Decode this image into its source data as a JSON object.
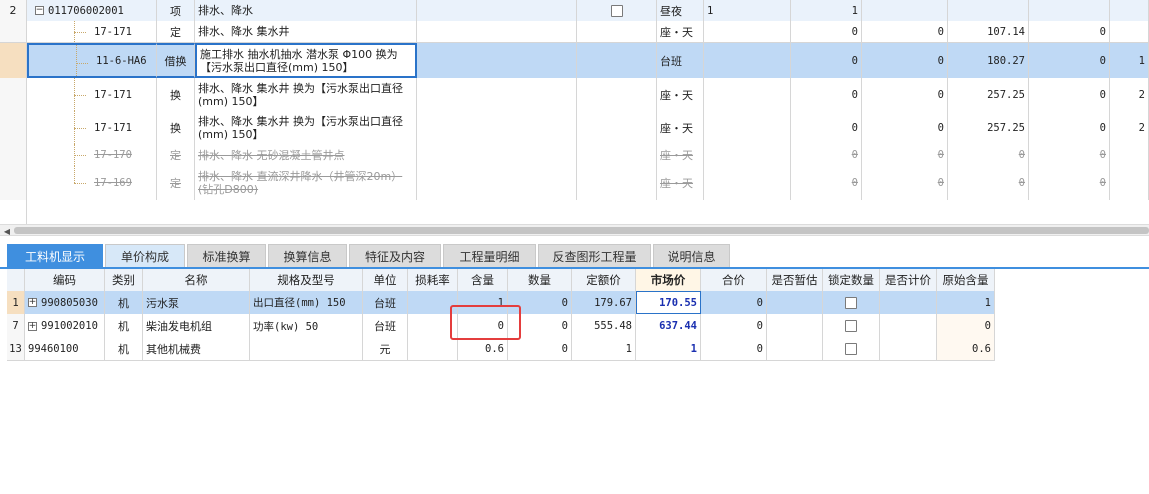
{
  "top_grid": {
    "rows": [
      {
        "num": "2",
        "code": "011706002001",
        "type": "项",
        "name": "排水、降水",
        "unit": "昼夜",
        "qty_expr": "1",
        "qty": "1",
        "amount": "",
        "unit_price": "",
        "total": "",
        "c13": "",
        "style": "header",
        "has_checkbox": true,
        "expander": "−"
      },
      {
        "num": "",
        "code": "17-171",
        "type": "定",
        "name": "排水、降水 集水井",
        "unit": "座・天",
        "qty_expr": "",
        "qty": "0",
        "amount": "0",
        "unit_price": "107.14",
        "total": "0",
        "c13": "",
        "style": "normal"
      },
      {
        "num": "",
        "code": "11-6-HA6",
        "type": "借换",
        "name": "施工排水 抽水机抽水 潜水泵 Φ100  换为【污水泵出口直径(mm) 150】",
        "unit": "台班",
        "qty_expr": "",
        "qty": "0",
        "amount": "0",
        "unit_price": "180.27",
        "total": "0",
        "c13": "1",
        "style": "selected"
      },
      {
        "num": "",
        "code": "17-171",
        "type": "换",
        "name": "排水、降水 集水井   换为【污水泵出口直径(mm) 150】",
        "unit": "座・天",
        "qty_expr": "",
        "qty": "0",
        "amount": "0",
        "unit_price": "257.25",
        "total": "0",
        "c13": "2",
        "style": "normal"
      },
      {
        "num": "",
        "code": "17-171",
        "type": "换",
        "name": "排水、降水 集水井    换为【污水泵出口直径(mm) 150】",
        "unit": "座・天",
        "qty_expr": "",
        "qty": "0",
        "amount": "0",
        "unit_price": "257.25",
        "total": "0",
        "c13": "2",
        "style": "normal"
      },
      {
        "num": "",
        "code": "17-170",
        "type": "定",
        "name": "排水、降水 无砂混凝土管井点",
        "unit": "座・天",
        "qty_expr": "",
        "qty": "0",
        "amount": "0",
        "unit_price": "0",
        "total": "0",
        "c13": "",
        "style": "strike"
      },
      {
        "num": "",
        "code": "17-169",
        "type": "定",
        "name": "排水、降水 直流深井降水（井管深20m）(钻孔D800)",
        "unit": "座・天",
        "qty_expr": "",
        "qty": "0",
        "amount": "0",
        "unit_price": "0",
        "total": "0",
        "c13": "",
        "style": "strike"
      }
    ]
  },
  "tabs": [
    {
      "label": "工料机显示",
      "active": true
    },
    {
      "label": "单价构成",
      "hover": true
    },
    {
      "label": "标准换算"
    },
    {
      "label": "换算信息"
    },
    {
      "label": "特征及内容"
    },
    {
      "label": "工程量明细"
    },
    {
      "label": "反查图形工程量"
    },
    {
      "label": "说明信息"
    }
  ],
  "bottom_grid": {
    "headers": [
      "编码",
      "类别",
      "名称",
      "规格及型号",
      "单位",
      "损耗率",
      "含量",
      "数量",
      "定额价",
      "市场价",
      "合价",
      "是否暂估",
      "锁定数量",
      "是否计价",
      "原始含量"
    ],
    "rows": [
      {
        "num": "1",
        "code": "990805030",
        "expander": "+",
        "cat": "机",
        "name": "污水泵",
        "spec": "出口直径(mm) 150",
        "unit": "台班",
        "loss": "",
        "content": "1",
        "qty": "0",
        "quota": "179.67",
        "market": "170.55",
        "total": "0",
        "est": "",
        "lock": true,
        "priced": "",
        "orig": "1",
        "style": "selected"
      },
      {
        "num": "7",
        "code": "991002010",
        "expander": "+",
        "cat": "机",
        "name": "柴油发电机组",
        "spec": "功率(kw) 50",
        "unit": "台班",
        "loss": "",
        "content": "0",
        "qty": "0",
        "quota": "555.48",
        "market": "637.44",
        "total": "0",
        "est": "",
        "lock": true,
        "priced": "",
        "orig": "0",
        "style": "normal"
      },
      {
        "num": "13",
        "code": "99460100",
        "expander": "",
        "cat": "机",
        "name": "其他机械费",
        "spec": "",
        "unit": "元",
        "loss": "",
        "content": "0.6",
        "qty": "0",
        "quota": "1",
        "market": "1",
        "total": "0",
        "est": "",
        "lock": true,
        "priced": "",
        "orig": "0.6",
        "style": "normal"
      }
    ]
  },
  "colors": {
    "accent": "#3f8fdf",
    "selected_row": "#bfd9f5",
    "highlight_box": "#e43d3d",
    "market_text": "#1a2fb0"
  }
}
